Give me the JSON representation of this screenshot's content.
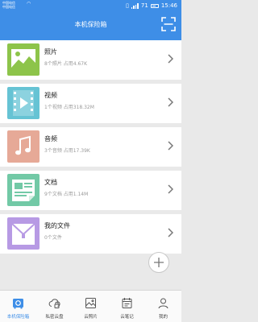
{
  "status_bar": {
    "carrier_line1": "中国电信",
    "carrier_line2": "中国电信",
    "battery": "71",
    "time": "15:46"
  },
  "header": {
    "title": "本机保险箱",
    "scan_icon": "scan-frame-icon"
  },
  "categories": [
    {
      "title": "照片",
      "subtitle": "8个照片  占用4.67K",
      "icon": "photo-icon",
      "color": "#8dc44a"
    },
    {
      "title": "视频",
      "subtitle": "1个视频  占用318.32M",
      "icon": "video-icon",
      "color": "#66c3d4"
    },
    {
      "title": "音频",
      "subtitle": "3个音频  占用17.39K",
      "icon": "audio-icon",
      "color": "#e6a997"
    },
    {
      "title": "文档",
      "subtitle": "9个文档  占用1.14M",
      "icon": "document-icon",
      "color": "#72c9a6"
    },
    {
      "title": "我的文件",
      "subtitle": "0个文件",
      "icon": "folder-icon",
      "color": "#b79ae4"
    }
  ],
  "nav": {
    "active_color": "#3e8ee7",
    "tabs": [
      {
        "label": "本机保险箱",
        "icon": "safe-icon",
        "active": true
      },
      {
        "label": "私密云盘",
        "icon": "cloud-lock-icon",
        "active": false
      },
      {
        "label": "云照片",
        "icon": "photo-icon",
        "active": false
      },
      {
        "label": "云笔记",
        "icon": "notebook-icon",
        "active": false
      },
      {
        "label": "我的",
        "icon": "person-icon",
        "active": false
      }
    ]
  }
}
